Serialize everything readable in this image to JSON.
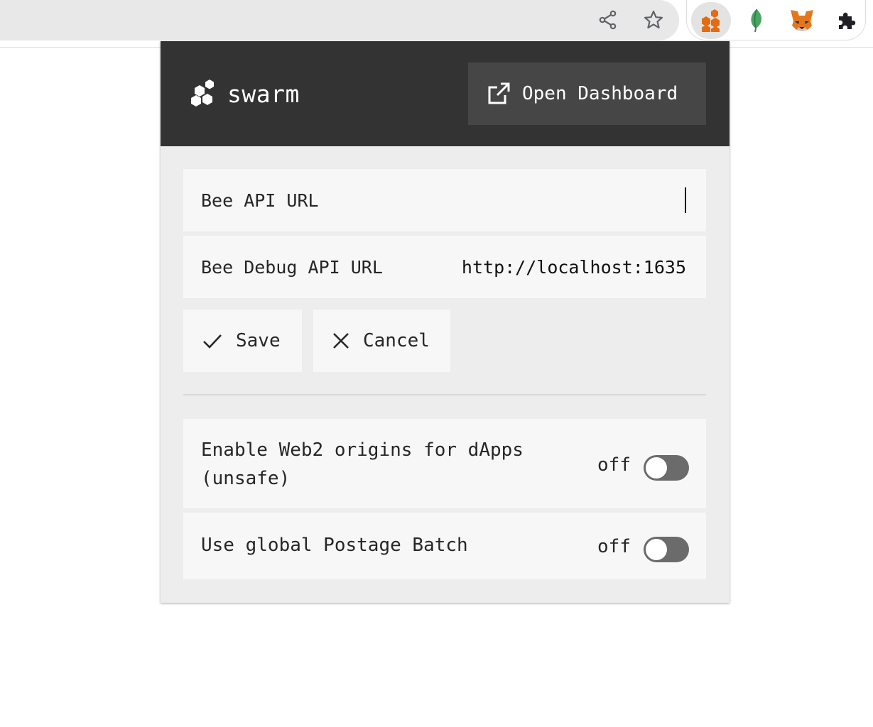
{
  "browser": {
    "extensions": [
      "swarm-extension-icon",
      "leaf-extension-icon",
      "metamask-fox-icon",
      "extensions-puzzle-icon"
    ]
  },
  "header": {
    "logo_text": "swarm",
    "dashboard_label": "Open Dashboard"
  },
  "settings": {
    "bee_api_label": "Bee API URL",
    "bee_api_value": "",
    "bee_debug_label": "Bee Debug API URL",
    "bee_debug_value": "http://localhost:1635"
  },
  "actions": {
    "save_label": "Save",
    "cancel_label": "Cancel"
  },
  "toggles": {
    "web2_label_line1": "Enable Web2 origins for dApps",
    "web2_label_line2": "(unsafe)",
    "web2_state": "off",
    "batch_label": "Use global Postage Batch",
    "batch_state": "off"
  },
  "colors": {
    "header_bg": "#333333",
    "popup_bg": "#ededed",
    "accent_orange": "#e46b12",
    "switch_off": "#6b6b6b"
  }
}
